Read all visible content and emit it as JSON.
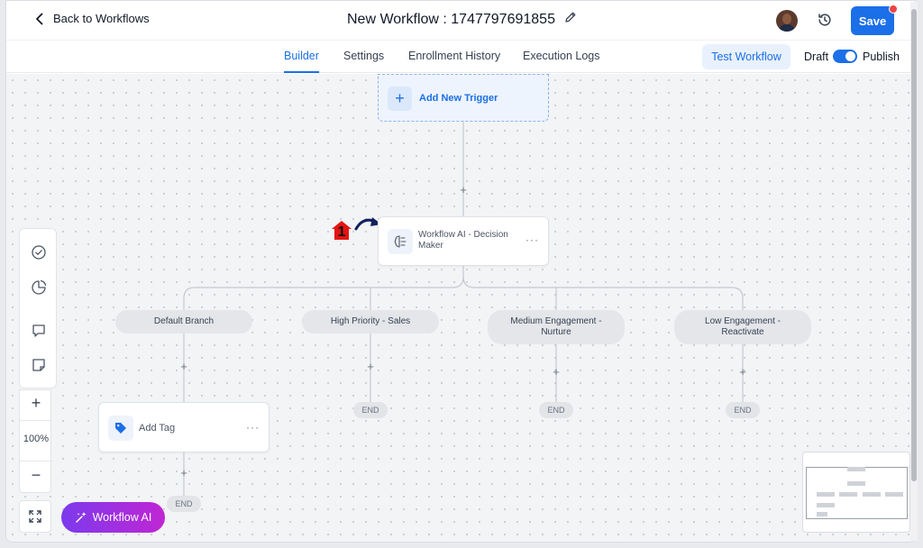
{
  "header": {
    "back_label": "Back to Workflows",
    "title": "New Workflow : 1747797691855",
    "save_label": "Save"
  },
  "tabs": [
    {
      "label": "Builder",
      "active": true
    },
    {
      "label": "Settings",
      "active": false
    },
    {
      "label": "Enrollment History",
      "active": false
    },
    {
      "label": "Execution Logs",
      "active": false
    }
  ],
  "actions": {
    "test_workflow_label": "Test Workflow",
    "draft_label": "Draft",
    "publish_label": "Publish",
    "publish_toggle_on": true
  },
  "canvas": {
    "trigger_label": "Add New Trigger",
    "decision_node_label": "Workflow AI - Decision Maker",
    "node_more": "···",
    "branches": [
      {
        "label": "Default Branch"
      },
      {
        "label": "High Priority - Sales"
      },
      {
        "label": "Medium Engagement - Nurture"
      },
      {
        "label": "Low Engagement - Reactivate"
      }
    ],
    "add_tag_label": "Add Tag",
    "end_label": "END",
    "annotation_number": "1"
  },
  "zoom": {
    "plus": "+",
    "level": "100%",
    "minus": "−"
  },
  "ai_button_label": "Workflow AI",
  "colors": {
    "accent": "#1b6fe8",
    "notification": "#ef4444",
    "ai_gradient_start": "#7c3aed",
    "ai_gradient_end": "#c026d3",
    "marker": "#e31313",
    "arrow": "#13235e"
  },
  "icons": {
    "back": "chevron-left-icon",
    "edit": "pencil-icon",
    "history": "history-icon",
    "trigger": "plus-icon",
    "decision": "ai-brain-icon",
    "tag": "tag-icon",
    "tools": [
      "check-circle-icon",
      "pie-chart-icon",
      "comment-icon",
      "sticky-note-icon"
    ],
    "fit": "fit-screen-icon",
    "ai": "sparkles-icon"
  }
}
